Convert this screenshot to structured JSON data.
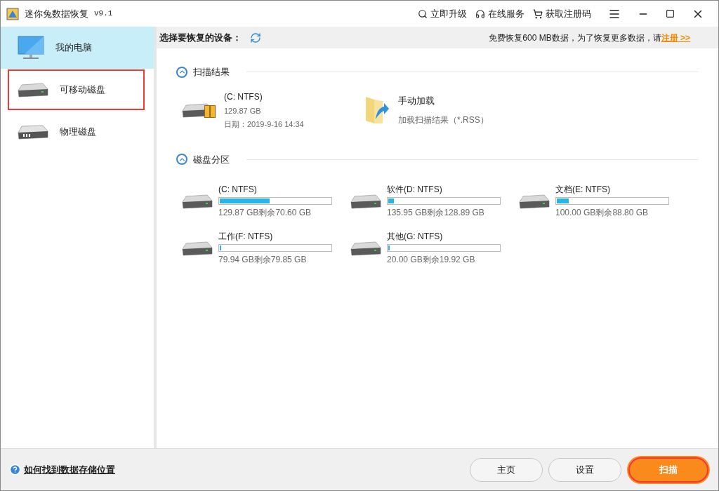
{
  "window": {
    "title": "迷你兔数据恢复",
    "version": "v9.1"
  },
  "title_actions": [
    {
      "kind": "upgrade",
      "label": "立即升级"
    },
    {
      "kind": "service",
      "label": "在线服务"
    },
    {
      "kind": "register",
      "label": "获取注册码"
    }
  ],
  "sidebar": {
    "items": [
      {
        "kind": "computer",
        "label": "我的电脑",
        "selected": true,
        "highlighted": false
      },
      {
        "kind": "removable",
        "label": "可移动磁盘",
        "selected": false,
        "highlighted": true
      },
      {
        "kind": "physical",
        "label": "物理磁盘",
        "selected": false,
        "highlighted": false
      }
    ]
  },
  "header": {
    "label": "选择要恢复的设备：",
    "notice": "免费恢复600 MB数据，为了恢复更多数据，请",
    "link": "注册 >>"
  },
  "scan_results": {
    "title": "扫描结果",
    "expanded": true,
    "result": {
      "name": "(C: NTFS)",
      "size": "129.87 GB",
      "date": "日期：2019-9-16 14:34"
    },
    "manual": {
      "title": "手动加载",
      "subtitle": "加载扫描结果（*.RSS）"
    }
  },
  "partitions": {
    "title": "磁盘分区",
    "expanded": true,
    "items": [
      {
        "name": "(C: NTFS)",
        "level": 0.45,
        "info": "129.87 GB剩余70.60 GB"
      },
      {
        "name": "软件(D: NTFS)",
        "level": 0.05,
        "info": "135.95 GB剩余128.89 GB"
      },
      {
        "name": "文档(E: NTFS)",
        "level": 0.11,
        "info": "100.00 GB剩余88.80 GB"
      },
      {
        "name": "工作(F: NTFS)",
        "level": 0.01,
        "info": "79.94 GB剩余79.85 GB"
      },
      {
        "name": "其他(G: NTFS)",
        "level": 0.01,
        "info": "20.00 GB剩余19.92 GB"
      }
    ]
  },
  "footer": {
    "help_link": "如何找到数据存储位置",
    "buttons": [
      {
        "kind": "home",
        "label": "主页",
        "highlighted": false
      },
      {
        "kind": "settings",
        "label": "设置",
        "highlighted": false
      },
      {
        "kind": "scan",
        "label": "扫描",
        "highlighted": true
      }
    ]
  }
}
